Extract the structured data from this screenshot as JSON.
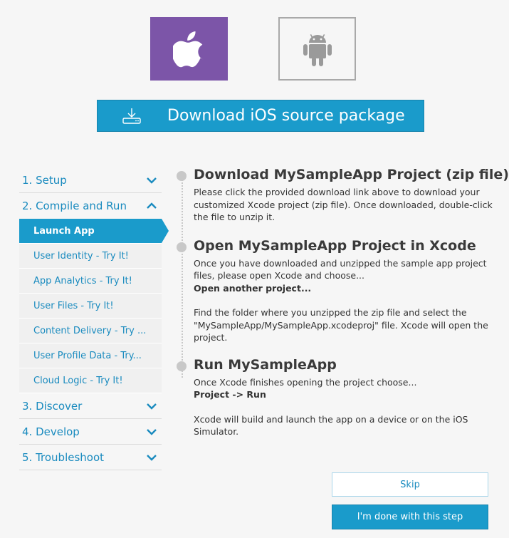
{
  "platforms": {
    "ios_icon": "apple-icon",
    "android_icon": "android-icon",
    "ios_color": "#7c55a8",
    "android_color": "#a9a9a9"
  },
  "download": {
    "label": "Download iOS source package",
    "icon": "download-icon"
  },
  "sidebar": {
    "sections": [
      {
        "label": "1. Setup",
        "expanded": false
      },
      {
        "label": "2. Compile and Run",
        "expanded": true
      },
      {
        "label": "3. Discover",
        "expanded": false
      },
      {
        "label": "4. Develop",
        "expanded": false
      },
      {
        "label": "5. Troubleshoot",
        "expanded": false
      }
    ],
    "sub_items": [
      {
        "label": "Launch App",
        "active": true
      },
      {
        "label": "User Identity - Try It!"
      },
      {
        "label": "App Analytics - Try It!"
      },
      {
        "label": "User Files - Try It!"
      },
      {
        "label": "Content Delivery - Try ..."
      },
      {
        "label": "User Profile Data - Try..."
      },
      {
        "label": "Cloud Logic - Try It!"
      }
    ]
  },
  "steps": [
    {
      "title": "Download MySampleApp Project (zip file)",
      "text": "Please click the provided download link above to download your customized Xcode project (zip file). Once downloaded, double-click the file to unzip it."
    },
    {
      "title": "Open MySampleApp Project in Xcode",
      "text": "Once you have downloaded and unzipped the sample app project files, please open Xcode and choose...",
      "bold": "Open another project...",
      "text2": "Find the folder where you unzipped the zip file and select the \"MySampleApp/MySampleApp.xcodeproj\" file. Xcode will open the project."
    },
    {
      "title": "Run MySampleApp",
      "text": "Once Xcode finishes opening the project choose...",
      "bold": "Project -> Run",
      "text2": "Xcode will build and launch the app on a device or on the iOS Simulator."
    }
  ],
  "buttons": {
    "skip": "Skip",
    "done": "I'm done with this step"
  },
  "colors": {
    "accent": "#1a9bcb",
    "link": "#1a8bbf"
  }
}
